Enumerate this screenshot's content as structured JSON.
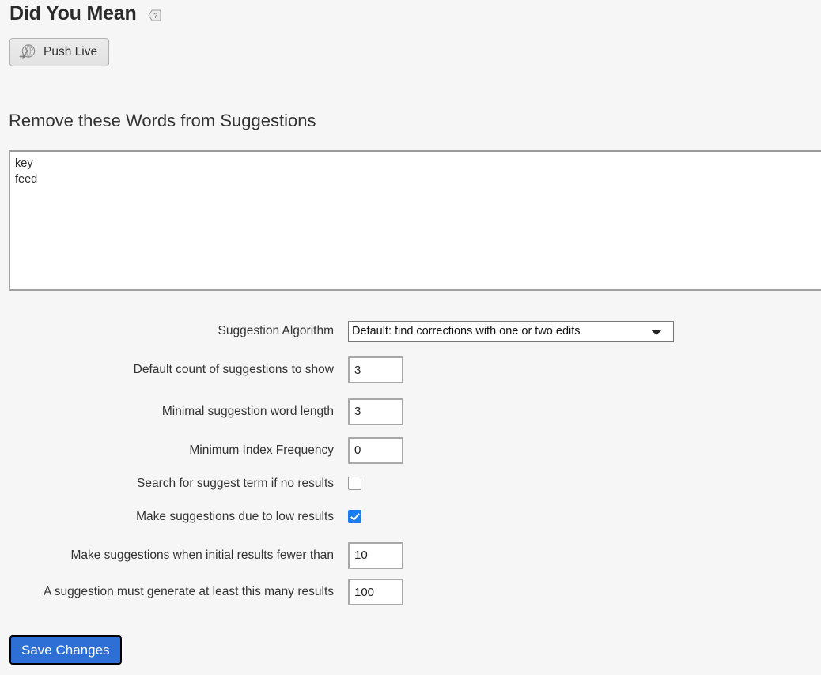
{
  "header": {
    "title": "Did You Mean",
    "help_icon": "help-tag-icon"
  },
  "toolbar": {
    "push_live_label": "Push Live",
    "push_live_icon": "globe-push-icon"
  },
  "section": {
    "heading": "Remove these Words from Suggestions",
    "words_value": "key\nfeed",
    "words_placeholder": ""
  },
  "form": {
    "algorithm": {
      "label": "Suggestion Algorithm",
      "selected": "Default: find corrections with one or two edits",
      "options": [
        "Default: find corrections with one or two edits"
      ]
    },
    "default_count": {
      "label": "Default count of suggestions to show",
      "value": "3"
    },
    "min_word_length": {
      "label": "Minimal suggestion word length",
      "value": "3"
    },
    "min_index_frequency": {
      "label": "Minimum Index Frequency",
      "value": "0"
    },
    "search_if_no_results": {
      "label": "Search for suggest term if no results",
      "checked": false
    },
    "suggest_low_results": {
      "label": "Make suggestions due to low results",
      "checked": true
    },
    "fewer_than": {
      "label": "Make suggestions when initial results fewer than",
      "value": "10"
    },
    "at_least": {
      "label": "A suggestion must generate at least this many results",
      "value": "100"
    }
  },
  "footer": {
    "save_label": "Save Changes"
  },
  "colors": {
    "page_background": "#f6f6f6",
    "accent_blue": "#2d6fd4",
    "checkbox_blue": "#1a7df0",
    "text": "#333333",
    "border_gray": "#a8a8a8"
  }
}
